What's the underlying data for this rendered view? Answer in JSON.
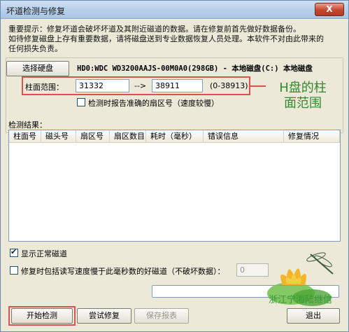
{
  "window": {
    "title": "坏道检测与修复",
    "close_label": "X"
  },
  "notice": {
    "line1": "重要提示：修复坏道会破坏坏道及其附近磁道的数据。请在修复前首先做好数据备份。",
    "line2": "如待修复磁盘上存有重要数据，请将磁盘送到专业数据恢复人员处理。本软件不对由此带来的",
    "line3": "任何损失负责。"
  },
  "disk": {
    "select_button": "选择硬盘",
    "info": "HD0:WDC WD3200AAJS-00M0A0(298GB) - 本地磁盘(C:) 本地磁盘"
  },
  "cylinder": {
    "label": "柱面范围：",
    "start": "31332",
    "arrow": "-->",
    "end": "38911",
    "range": "(0-38913)"
  },
  "annotation": {
    "line1": "H盘的柱",
    "line2": "面范围"
  },
  "options": {
    "precise_label": "检测时报告准确的扇区号（速度较慢）",
    "precise_checked": false,
    "show_normal_label": "显示正常磁道",
    "show_normal_checked": true,
    "include_slow_label": "修复时包括读写速度慢于此毫秒数的好磁道（不破坏数据）：",
    "include_slow_checked": false,
    "ms_value": "0"
  },
  "results": {
    "label": "检测结果：",
    "columns": [
      "柱面号",
      "磁头号",
      "扇区号",
      "扇区数目",
      "耗时（毫秒）",
      "错误信息",
      "修复情况"
    ],
    "rows": []
  },
  "buttons": {
    "start": "开始检测",
    "try_repair": "尝试修复",
    "save_report": "保存报表",
    "exit": "退出"
  },
  "watermark": {
    "text": "浙江宁海陆继信"
  },
  "colors": {
    "annotation_red": "#d9534f",
    "annotation_green": "#2e8b2e",
    "window_bg": "#ece9d8"
  }
}
